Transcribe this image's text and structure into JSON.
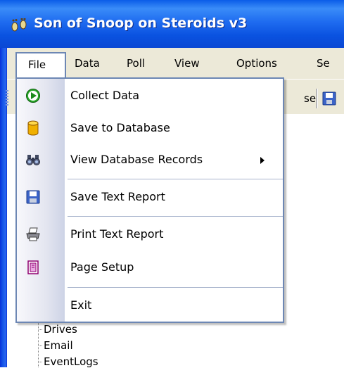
{
  "window": {
    "title": "Son of Snoop on Steroids v3",
    "icon": "footprints-icon"
  },
  "menu_bar": {
    "items": [
      {
        "label": "File",
        "active": true
      },
      {
        "label": "Data"
      },
      {
        "label": "Poll"
      },
      {
        "label": "View"
      },
      {
        "label": "Options"
      },
      {
        "label": "Se"
      }
    ]
  },
  "toolbar": {
    "partial_label": "se",
    "save_icon": "floppy-disk-icon"
  },
  "file_menu": {
    "items": [
      {
        "label": "Collect Data",
        "icon": "green-play-icon"
      },
      {
        "label": "Save to Database",
        "icon": "database-cylinder-icon"
      },
      {
        "label": "View Database Records",
        "icon": "binoculars-icon",
        "submenu": true
      },
      {
        "label": "Save Text Report",
        "icon": "floppy-disk-icon"
      },
      {
        "label": "Print Text Report",
        "icon": "printer-icon"
      },
      {
        "label": "Page Setup",
        "icon": "page-setup-icon"
      },
      {
        "label": "Exit"
      }
    ]
  },
  "tree": {
    "items": [
      "Drives",
      "Email",
      "EventLogs"
    ]
  },
  "colors": {
    "title_bar": "#0a5ce8",
    "menu_border": "#6d87b4",
    "menu_bar_bg": "#ece9d8"
  }
}
